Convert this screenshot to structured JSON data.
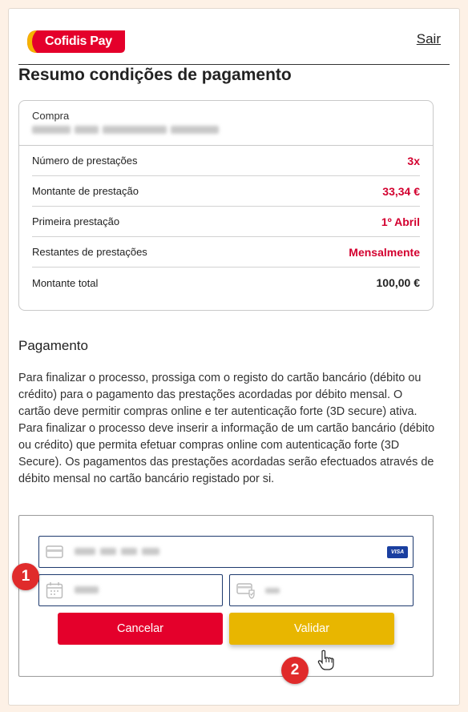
{
  "brand": {
    "name": "Cofidis Pay",
    "colors": {
      "red": "#e4002b",
      "yellow": "#f5b400",
      "accent_value": "#d3002f"
    }
  },
  "header": {
    "logout_label": "Sair"
  },
  "title": "Resumo condições de pagamento",
  "summary": {
    "purchase_label": "Compra",
    "rows": [
      {
        "label": "Número de prestações",
        "value": "3x"
      },
      {
        "label": "Montante de prestação",
        "value": "33,34 €"
      },
      {
        "label": "Primeira prestação",
        "value": "1º Abril"
      },
      {
        "label": "Restantes de prestações",
        "value": "Mensalmente"
      },
      {
        "label": "Montante total",
        "value": "100,00 €"
      }
    ]
  },
  "payment": {
    "title": "Pagamento",
    "text": "Para finalizar o processo, prossiga com o registo do cartão bancário (débito ou crédito) para o pagamento das prestações acordadas por débito mensal. O cartão deve permitir compras online e ter autenticação forte (3D secure) ativa.\nPara finalizar o processo deve inserir a informação de um cartão bancário (débito ou crédito) que permita efetuar compras online com autenticação forte (3D Secure). Os pagamentos das prestações acordadas serão efectuados através de débito mensal no cartão bancário registado por si.",
    "card_brand": "VISA",
    "icons": {
      "card_field": "credit-card-icon",
      "date_field": "calendar-icon",
      "cvv_field": "card-shield-icon"
    },
    "cancel_label": "Cancelar",
    "validate_label": "Validar"
  },
  "annotations": {
    "marker_1": "1",
    "marker_2": "2"
  }
}
